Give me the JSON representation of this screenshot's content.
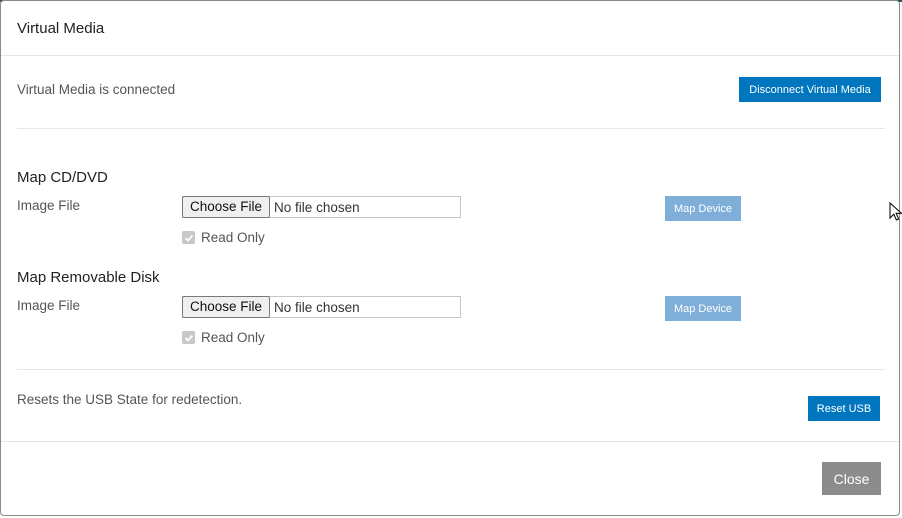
{
  "dialog": {
    "title": "Virtual Media"
  },
  "connection": {
    "status_text": "Virtual Media is connected",
    "disconnect_label": "Disconnect Virtual Media"
  },
  "cd_dvd": {
    "section_title": "Map CD/DVD",
    "field_label": "Image File",
    "choose_file_label": "Choose File",
    "file_status": "No file chosen",
    "read_only_label": "Read Only",
    "read_only_checked": true,
    "map_button_label": "Map Device"
  },
  "removable_disk": {
    "section_title": "Map Removable Disk",
    "field_label": "Image File",
    "choose_file_label": "Choose File",
    "file_status": "No file chosen",
    "read_only_label": "Read Only",
    "read_only_checked": true,
    "map_button_label": "Map Device"
  },
  "usb": {
    "description": "Resets the USB State for redetection.",
    "reset_label": "Reset USB"
  },
  "footer": {
    "close_label": "Close"
  },
  "colors": {
    "primary": "#0076be",
    "disabled_primary": "#7fafd8",
    "close_button": "#8c8c8c"
  },
  "icons": {
    "cursor": "mouse-pointer-icon",
    "checkmark": "checkmark-icon"
  }
}
